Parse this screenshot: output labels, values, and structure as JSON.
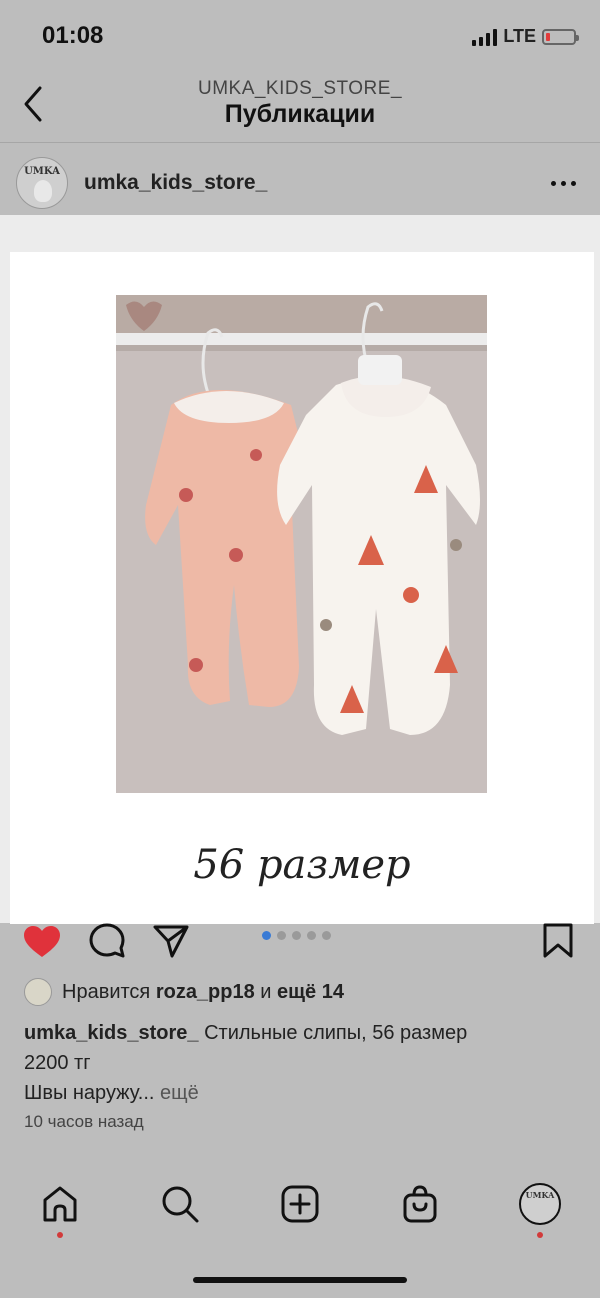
{
  "status_bar": {
    "time": "01:08",
    "network": "LTE",
    "battery_level": 0.15,
    "battery_color": "#e23b3b"
  },
  "header": {
    "account": "UMKA_KIDS_STORE_",
    "title": "Публикации",
    "back_icon": "chevron-left-icon"
  },
  "post": {
    "username": "umka_kids_store_",
    "avatar_text": "UMKA",
    "more_icon": "more-horizontal-icon",
    "image_caption": "56 размер",
    "carousel": {
      "count": 5,
      "active": 1
    },
    "actions": {
      "like_icon": "heart-filled-icon",
      "like_color": "#e0323b",
      "comment_icon": "comment-icon",
      "share_icon": "send-icon",
      "save_icon": "bookmark-icon"
    },
    "likes": {
      "prefix": "Нравится ",
      "user": "roza_pp18",
      "middle": " и ",
      "others": "ещё 14"
    },
    "caption": {
      "username": "umka_kids_store_",
      "text": " Стильные слипы, 56 размер",
      "line2": "2200 тг",
      "line3": "Швы наружу...",
      "more": " ещё"
    },
    "time_ago": "10 часов назад"
  },
  "tab_bar": {
    "items": [
      "home-icon",
      "search-icon",
      "add-post-icon",
      "shop-bag-icon",
      "profile-avatar"
    ],
    "profile_avatar_text": "UMKA",
    "dot_color": "#d23a3a"
  }
}
